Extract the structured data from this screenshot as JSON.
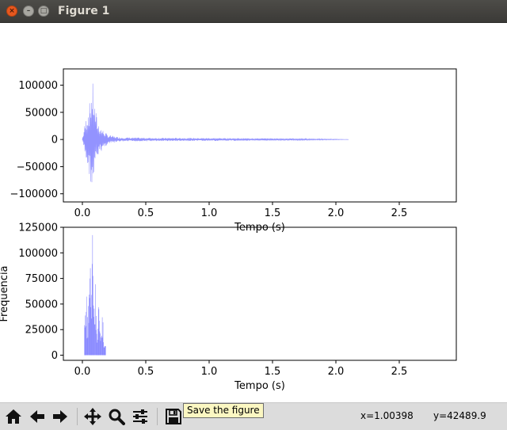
{
  "window": {
    "title": "Figure 1",
    "close_glyph": "×",
    "min_glyph": "–",
    "max_glyph": "□"
  },
  "toolbar": {
    "buttons": [
      {
        "name": "home-button",
        "icon": "home-icon"
      },
      {
        "name": "back-button",
        "icon": "arrow-left-icon"
      },
      {
        "name": "forward-button",
        "icon": "arrow-right-icon"
      },
      {
        "name": "pan-button",
        "icon": "move-icon"
      },
      {
        "name": "zoom-button",
        "icon": "magnifier-icon"
      },
      {
        "name": "subplots-button",
        "icon": "sliders-icon"
      },
      {
        "name": "save-button",
        "icon": "floppy-disk-icon"
      }
    ],
    "tooltip": "Save the figure",
    "coord_x": "x=1.00398",
    "coord_y": "y=42489.9"
  },
  "colors": {
    "signal": "#3a3aff",
    "background": "#ffffff",
    "toolbar": "#dcdcdc"
  },
  "chart_data": [
    {
      "type": "line",
      "xlabel": "Tempo (s)",
      "ylabel": "",
      "xlim": [
        -0.15,
        2.95
      ],
      "ylim": [
        -115000,
        130000
      ],
      "xticks": [
        0.0,
        0.5,
        1.0,
        1.5,
        2.0,
        2.5
      ],
      "xtick_labels": [
        "0.0",
        "0.5",
        "1.0",
        "1.5",
        "2.0",
        "2.5"
      ],
      "yticks": [
        100000,
        50000,
        0,
        -50000,
        -100000
      ],
      "ytick_labels": [
        "100000",
        "50000",
        "0",
        "−50000",
        "−100000"
      ],
      "grid": false,
      "series": [
        {
          "x": [
            0.0,
            0.02,
            0.04,
            0.06,
            0.08,
            0.1,
            0.12,
            0.14,
            0.16,
            0.2,
            0.25,
            0.3,
            0.4,
            0.6,
            0.8,
            1.0,
            1.2,
            1.4,
            1.6,
            1.8,
            2.0,
            2.1
          ],
          "envelope": [
            2000,
            30000,
            55000,
            70000,
            110000,
            60000,
            35000,
            25000,
            18000,
            9000,
            6000,
            4000,
            3500,
            3000,
            3000,
            2800,
            2500,
            2200,
            1800,
            1200,
            600,
            0
          ]
        }
      ]
    },
    {
      "type": "line",
      "xlabel": "Tempo (s)",
      "ylabel": "Frequencia",
      "xlim": [
        -0.15,
        2.95
      ],
      "ylim": [
        -5000,
        125000
      ],
      "xticks": [
        0.0,
        0.5,
        1.0,
        1.5,
        2.0,
        2.5
      ],
      "xtick_labels": [
        "0.0",
        "0.5",
        "1.0",
        "1.5",
        "2.0",
        "2.5"
      ],
      "yticks": [
        125000,
        100000,
        75000,
        50000,
        25000,
        0
      ],
      "ytick_labels": [
        "125000",
        "100000",
        "75000",
        "50000",
        "25000",
        "0"
      ],
      "grid": false,
      "series": [
        {
          "x": [
            0.02,
            0.03,
            0.04,
            0.05,
            0.06,
            0.07,
            0.08,
            0.09,
            0.1,
            0.11,
            0.12,
            0.13,
            0.14,
            0.15,
            0.16,
            0.17,
            0.18
          ],
          "values": [
            55000,
            70000,
            40000,
            60000,
            90000,
            65000,
            118000,
            50000,
            72000,
            45000,
            30000,
            55000,
            25000,
            20000,
            38000,
            15000,
            12000
          ]
        }
      ]
    }
  ]
}
